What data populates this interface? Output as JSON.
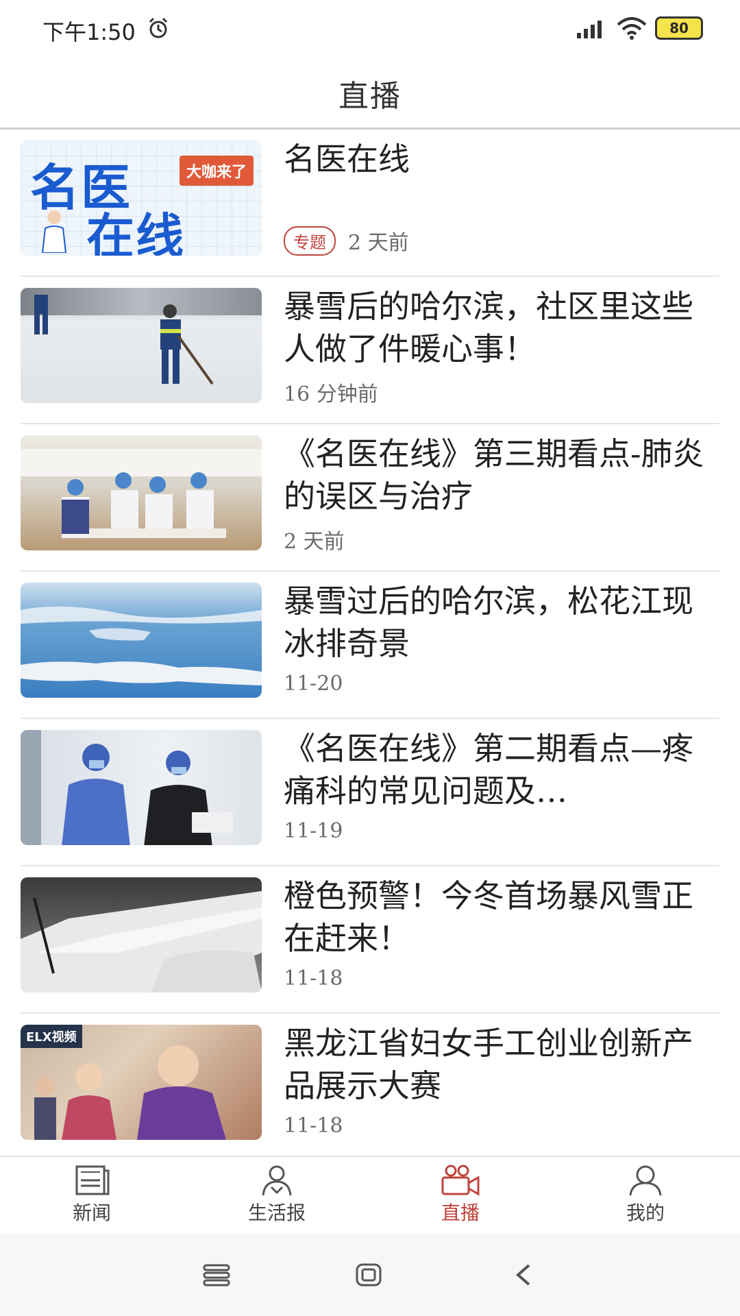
{
  "status_bar": {
    "time": "下午1:50",
    "battery": "80"
  },
  "header": {
    "title": "直播"
  },
  "items": [
    {
      "title": "名医在线",
      "tag": "专题",
      "time": "2 天前",
      "thumb_text_main": "名医",
      "thumb_text_sub": "在线",
      "thumb_banner": "大咖来了"
    },
    {
      "title": "暴雪后的哈尔滨，社区里这些人做了件暖心事！",
      "time": "16 分钟前"
    },
    {
      "title": "《名医在线》第三期看点-肺炎的误区与治疗",
      "time": "2 天前"
    },
    {
      "title": "暴雪过后的哈尔滨，松花江现冰排奇景",
      "time": "11-20"
    },
    {
      "title": "《名医在线》第二期看点—疼痛科的常见问题及…",
      "time": "11-19"
    },
    {
      "title": "橙色预警！今冬首场暴风雪正在赶来！",
      "time": "11-18"
    },
    {
      "title": "黑龙江省妇女手工创业创新产品展示大赛",
      "time": "11-18",
      "thumb_sign": "ELX视频"
    }
  ],
  "nav": [
    {
      "label": "新闻",
      "icon": "newspaper-icon",
      "active": false
    },
    {
      "label": "生活报",
      "icon": "person-group-icon",
      "active": false
    },
    {
      "label": "直播",
      "icon": "live-camera-icon",
      "active": true
    },
    {
      "label": "我的",
      "icon": "user-icon",
      "active": false
    }
  ],
  "colors": {
    "accent": "#c0433c",
    "divider": "#e6e6e6"
  }
}
